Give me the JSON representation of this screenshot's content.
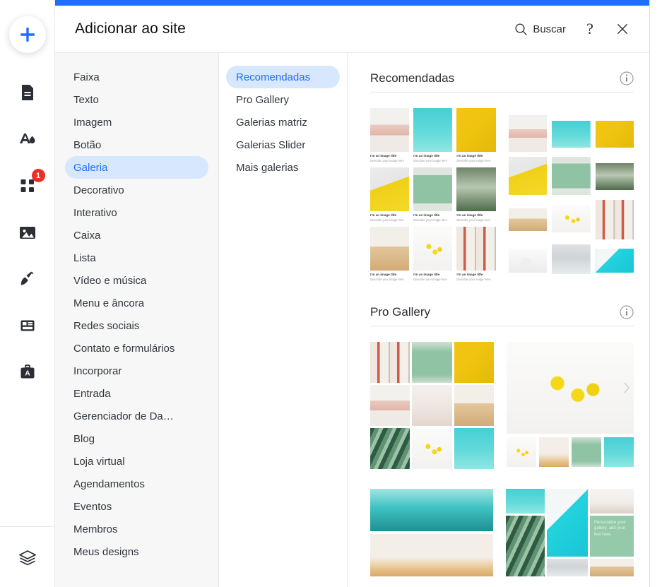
{
  "window": {
    "accent_blue": "#1f6fff",
    "badge_red": "#ee2e24"
  },
  "rail": {
    "add_button_label": "+",
    "items": [
      {
        "name": "pages-icon",
        "badge": null
      },
      {
        "name": "site-design-icon",
        "badge": null
      },
      {
        "name": "add-elements-icon",
        "badge": "1"
      },
      {
        "name": "media-icon",
        "badge": null
      },
      {
        "name": "blog-icon",
        "badge": null
      },
      {
        "name": "apps-icon",
        "badge": null
      },
      {
        "name": "business-tools-icon",
        "badge": null
      }
    ],
    "bottom_item": {
      "name": "layers-icon"
    }
  },
  "header": {
    "title": "Adicionar ao site",
    "search_label": "Buscar",
    "help_label": "?",
    "close_label": "✕"
  },
  "categories": {
    "items": [
      {
        "label": "Faixa",
        "active": false
      },
      {
        "label": "Texto",
        "active": false
      },
      {
        "label": "Imagem",
        "active": false
      },
      {
        "label": "Botão",
        "active": false
      },
      {
        "label": "Galeria",
        "active": true
      },
      {
        "label": "Decorativo",
        "active": false
      },
      {
        "label": "Interativo",
        "active": false
      },
      {
        "label": "Caixa",
        "active": false
      },
      {
        "label": "Lista",
        "active": false
      },
      {
        "label": "Vídeo e música",
        "active": false
      },
      {
        "label": "Menu e âncora",
        "active": false
      },
      {
        "label": "Redes sociais",
        "active": false
      },
      {
        "label": "Contato e formulários",
        "active": false
      },
      {
        "label": "Incorporar",
        "active": false
      },
      {
        "label": "Entrada",
        "active": false
      },
      {
        "label": "Gerenciador de Da…",
        "active": false
      },
      {
        "label": "Blog",
        "active": false
      },
      {
        "label": "Loja virtual",
        "active": false
      },
      {
        "label": "Agendamentos",
        "active": false
      },
      {
        "label": "Eventos",
        "active": false
      },
      {
        "label": "Membros",
        "active": false
      },
      {
        "label": "Meus designs",
        "active": false
      }
    ]
  },
  "subcategories": {
    "items": [
      {
        "label": "Recomendadas",
        "active": true
      },
      {
        "label": "Pro Gallery",
        "active": false
      },
      {
        "label": "Galerias matriz",
        "active": false
      },
      {
        "label": "Galerias Slider",
        "active": false
      },
      {
        "label": "Mais galerias",
        "active": false
      }
    ]
  },
  "sections": [
    {
      "title": "Recomendadas",
      "info_icon": "info-icon"
    },
    {
      "title": "Pro Gallery",
      "info_icon": "info-icon"
    }
  ],
  "thumb_caption": {
    "title": "I'm an image title",
    "description": "Describe your image here"
  },
  "collage_text": "Personalize your gallery, add your text here."
}
